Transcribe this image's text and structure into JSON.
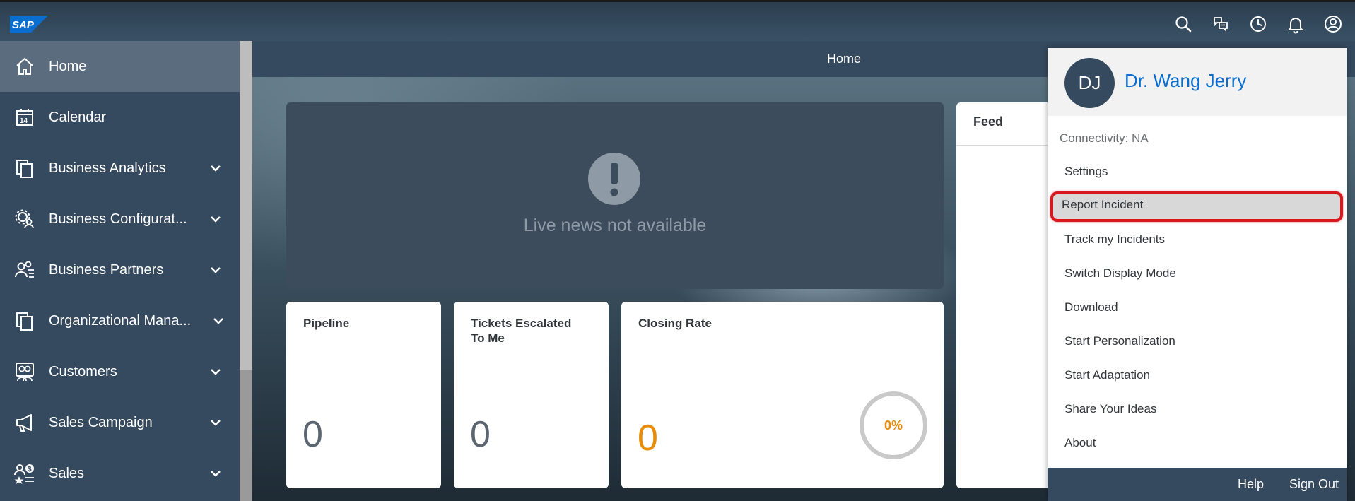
{
  "shell": {
    "logo_text": "SAP",
    "icons": [
      "search-icon",
      "chat-icon",
      "history-icon",
      "bell-icon",
      "user-icon"
    ]
  },
  "sidebar": {
    "items": [
      {
        "label": "Home",
        "icon": "home-icon",
        "active": true,
        "has_chevron": false
      },
      {
        "label": "Calendar",
        "icon": "calendar-icon",
        "calendar_day": "14",
        "has_chevron": false
      },
      {
        "label": "Business Analytics",
        "icon": "documents-icon",
        "has_chevron": true
      },
      {
        "label": "Business Configurat...",
        "icon": "config-icon",
        "has_chevron": true
      },
      {
        "label": "Business Partners",
        "icon": "partners-icon",
        "has_chevron": true
      },
      {
        "label": "Organizational Mana...",
        "icon": "documents-icon",
        "has_chevron": true
      },
      {
        "label": "Customers",
        "icon": "customers-icon",
        "has_chevron": true
      },
      {
        "label": "Sales Campaign",
        "icon": "megaphone-icon",
        "has_chevron": true
      },
      {
        "label": "Sales",
        "icon": "sales-icon",
        "has_chevron": true
      }
    ]
  },
  "main": {
    "page_title": "Home",
    "news": {
      "message": "Live news not available",
      "icon": "exclamation-icon"
    },
    "tiles": [
      {
        "title": "Pipeline",
        "value": "0"
      },
      {
        "title_line1": "Tickets Escalated",
        "title_line2": "To Me",
        "value": "0"
      },
      {
        "title": "Closing Rate",
        "value": "0",
        "ring_label": "0%",
        "ring_value": 0
      }
    ],
    "feed": {
      "title": "Feed"
    }
  },
  "user_menu": {
    "initials": "DJ",
    "name": "Dr. Wang Jerry",
    "connectivity": "Connectivity: NA",
    "items": [
      "Settings",
      "Report Incident",
      "Track my Incidents",
      "Switch Display Mode",
      "Download",
      "Start Personalization",
      "Start Adaptation",
      "Share Your Ideas",
      "About"
    ],
    "highlighted": "Report Incident",
    "footer": {
      "help": "Help",
      "sign_out": "Sign Out"
    }
  },
  "colors": {
    "shell": "#354a5f",
    "accent_blue": "#0a6ed1",
    "orange": "#e78c07",
    "highlight_red": "#d7191e"
  }
}
